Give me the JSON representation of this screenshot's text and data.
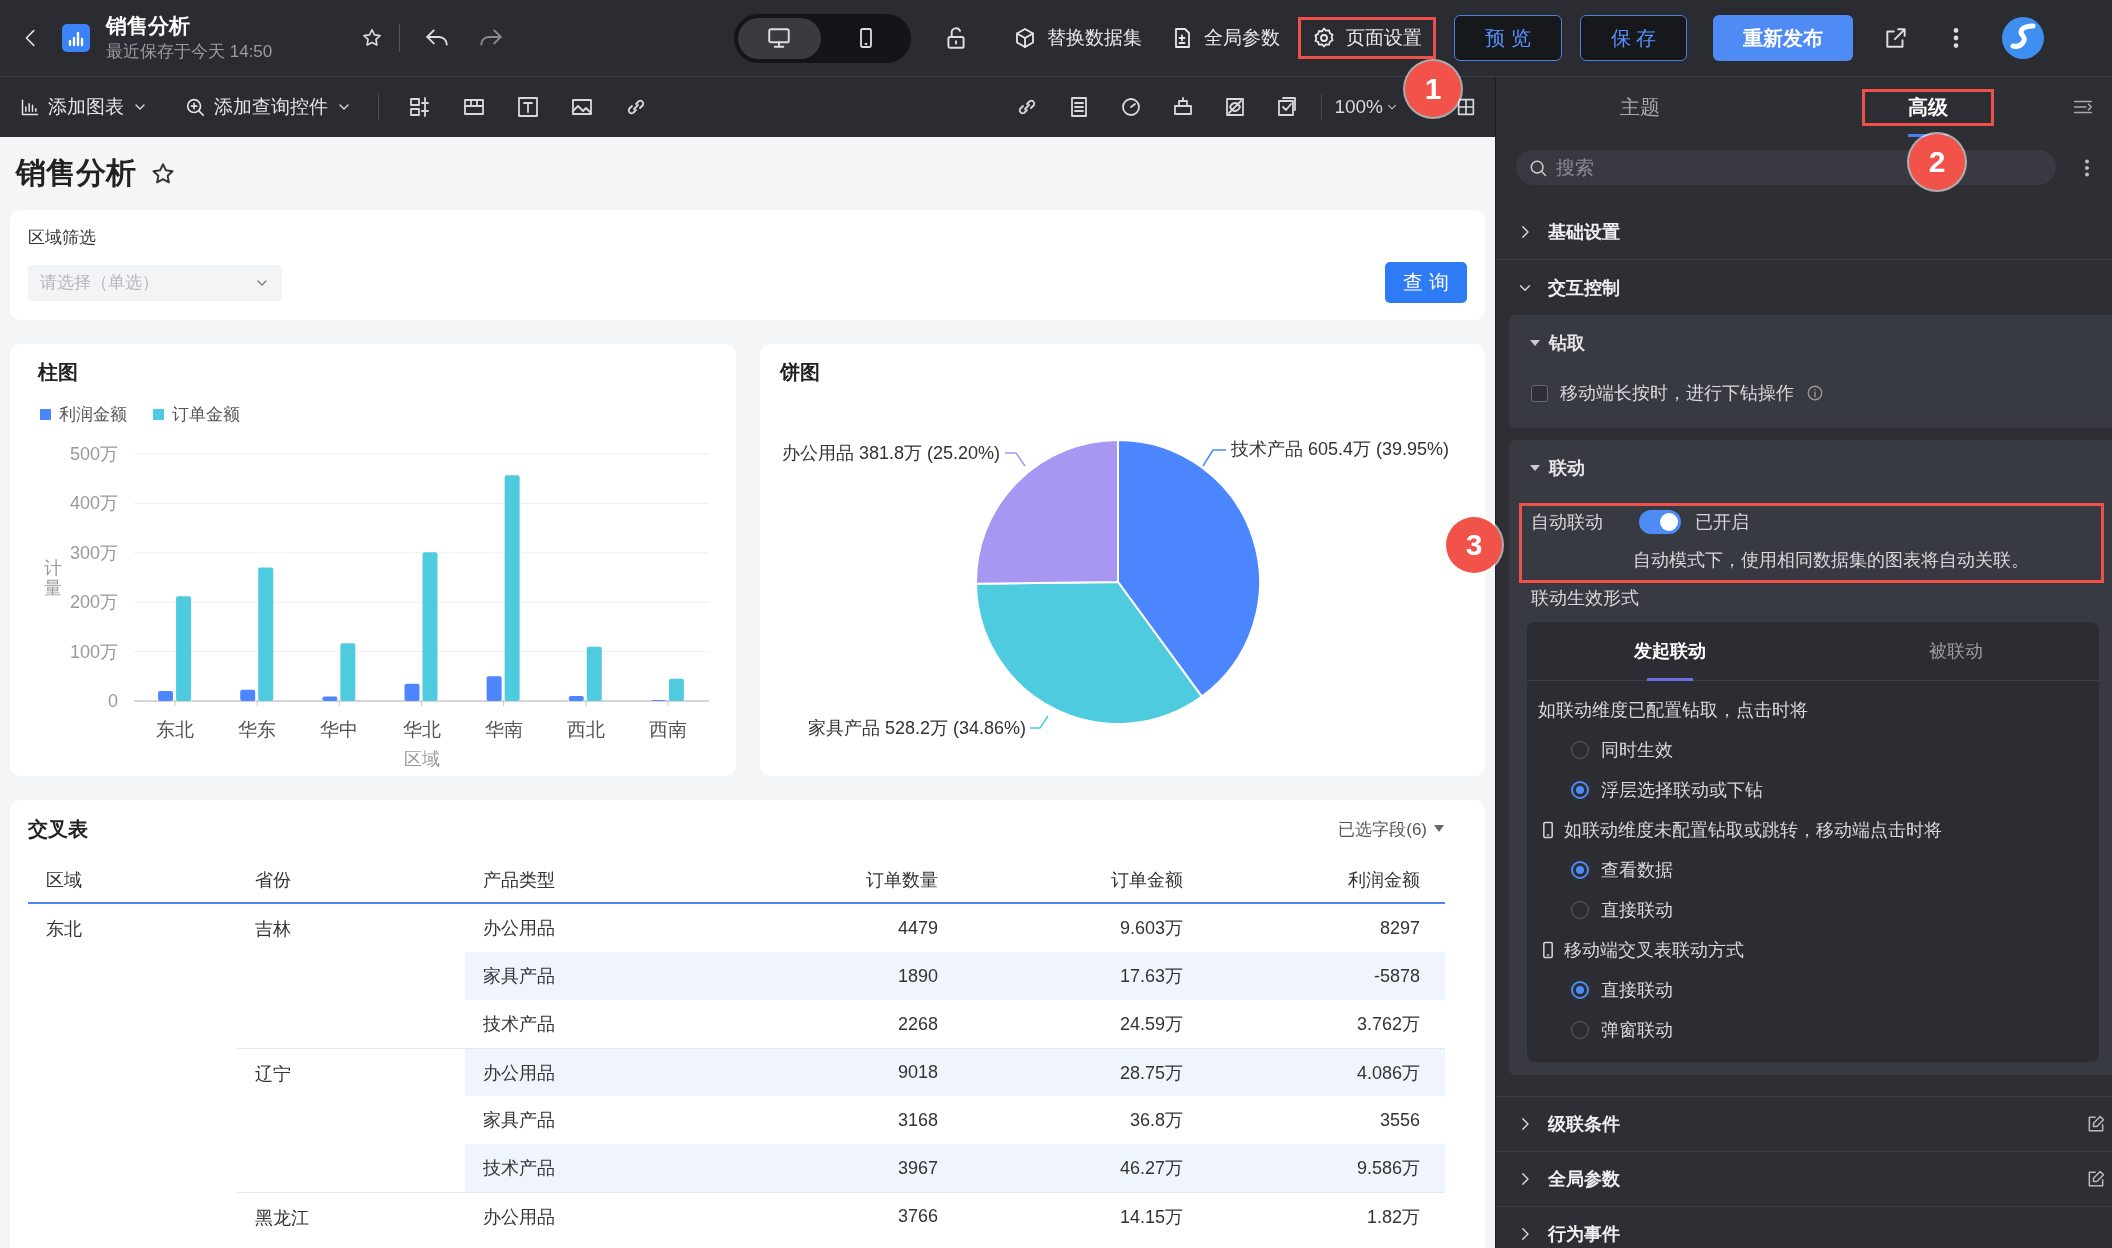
{
  "header": {
    "title": "销售分析",
    "subtitle": "最近保存于今天 14:50",
    "device_modes": [
      {
        "kind": "desktop",
        "selected": true
      },
      {
        "kind": "mobile",
        "selected": false
      }
    ],
    "actions": [
      {
        "label": "替换数据集",
        "highlighted": false
      },
      {
        "label": "全局参数",
        "highlighted": false
      },
      {
        "label": "页面设置",
        "highlighted": true
      }
    ],
    "buttons": [
      {
        "label": "预 览",
        "kind": "outline"
      },
      {
        "label": "保 存",
        "kind": "outline"
      },
      {
        "label": "重新发布",
        "kind": "primary"
      }
    ]
  },
  "toolbar": {
    "menus": [
      {
        "label": "添加图表"
      },
      {
        "label": "添加查询控件"
      }
    ],
    "zoom": "100%"
  },
  "page": {
    "title": "销售分析",
    "filter": {
      "label": "区域筛选",
      "placeholder": "请选择（单选）",
      "button": "查 询"
    },
    "bar_card": {
      "chart_data": {
        "type": "bar",
        "title": "柱图",
        "xlabel": "区域",
        "ylabel": "计量",
        "categories": [
          "东北",
          "华东",
          "华中",
          "华北",
          "华南",
          "西北",
          "西南"
        ],
        "series": [
          {
            "name": "利润金额",
            "color": "#4c86ff",
            "values": [
              20,
              23,
              9,
              35,
              50,
              10,
              2
            ]
          },
          {
            "name": "订单金额",
            "color": "#4ecbdf",
            "values": [
              212,
              270,
              117,
              301,
              457,
              110,
              45
            ]
          }
        ],
        "ylim": [
          0,
          500
        ],
        "grid": true,
        "yticks": [
          {
            "value": 0,
            "label": "0"
          },
          {
            "value": 100,
            "label": "100万"
          },
          {
            "value": 200,
            "label": "200万"
          },
          {
            "value": 300,
            "label": "300万"
          },
          {
            "value": 400,
            "label": "400万"
          },
          {
            "value": 500,
            "label": "500万"
          }
        ]
      }
    },
    "pie_card": {
      "chart_data": {
        "type": "pie",
        "title": "饼图",
        "categories": [
          "技术产品",
          "家具产品",
          "办公用品"
        ],
        "values": [
          605.4,
          528.2,
          381.8
        ],
        "colors": [
          "#4c86ff",
          "#4ecbdf",
          "#a797f3"
        ],
        "value_labels": [
          "605.4万 (39.95%)",
          "528.2万 (34.86%)",
          "381.8万 (25.20%)"
        ]
      }
    },
    "table_card": {
      "title": "交叉表",
      "fields_selector": "已选字段(6)",
      "columns": [
        "区域",
        "省份",
        "产品类型",
        "订单数量",
        "订单金额",
        "利润金额"
      ],
      "groups": [
        {
          "region": "东北",
          "provinces": [
            {
              "name": "吉林",
              "rows": [
                {
                  "product": "办公用品",
                  "cells": [
                    "4479",
                    "9.603万",
                    "8297"
                  ]
                },
                {
                  "product": "家具产品",
                  "cells": [
                    "1890",
                    "17.63万",
                    "-5878"
                  ]
                },
                {
                  "product": "技术产品",
                  "cells": [
                    "2268",
                    "24.59万",
                    "3.762万"
                  ]
                }
              ]
            },
            {
              "name": "辽宁",
              "rows": [
                {
                  "product": "办公用品",
                  "cells": [
                    "9018",
                    "28.75万",
                    "4.086万"
                  ]
                },
                {
                  "product": "家具产品",
                  "cells": [
                    "3168",
                    "36.8万",
                    "3556"
                  ]
                },
                {
                  "product": "技术产品",
                  "cells": [
                    "3967",
                    "46.27万",
                    "9.586万"
                  ]
                }
              ]
            },
            {
              "name": "黑龙江",
              "rows": [
                {
                  "product": "办公用品",
                  "cells": [
                    "3766",
                    "14.15万",
                    "1.82万"
                  ]
                }
              ]
            }
          ]
        }
      ]
    }
  },
  "settings_panel": {
    "tabs": [
      {
        "label": "主题",
        "selected": false,
        "highlighted": false
      },
      {
        "label": "高级",
        "selected": true,
        "highlighted": true
      }
    ],
    "search": {
      "placeholder": "搜索"
    },
    "sections": [
      {
        "title": "基础设置",
        "expanded": false,
        "editable": false
      },
      {
        "title": "交互控制",
        "expanded": true,
        "editable": false,
        "groups": [
          {
            "title": "钻取",
            "items": [
              {
                "kind": "checkbox",
                "label": "移动端长按时，进行下钻操作",
                "checked": false,
                "info": true
              }
            ]
          },
          {
            "title": "联动",
            "items": [
              {
                "kind": "toggle",
                "label": "自动联动",
                "on": true,
                "status": "已开启",
                "description": "自动模式下，使用相同数据集的图表将自动关联。",
                "highlighted": true
              },
              {
                "kind": "heading",
                "label": "联动生效形式"
              },
              {
                "kind": "tabbox",
                "tabs": [
                  {
                    "label": "发起联动",
                    "selected": true
                  },
                  {
                    "label": "被联动",
                    "selected": false
                  }
                ],
                "blocks": [
                  {
                    "label": "如联动维度已配置钻取，点击时将",
                    "mobile": false,
                    "options": [
                      {
                        "label": "同时生效",
                        "selected": false
                      },
                      {
                        "label": "浮层选择联动或下钻",
                        "selected": true
                      }
                    ]
                  },
                  {
                    "label": "如联动维度未配置钻取或跳转，移动端点击时将",
                    "mobile": true,
                    "options": [
                      {
                        "label": "查看数据",
                        "selected": true
                      },
                      {
                        "label": "直接联动",
                        "selected": false
                      }
                    ]
                  },
                  {
                    "label": "移动端交叉表联动方式",
                    "mobile": true,
                    "options": [
                      {
                        "label": "直接联动",
                        "selected": true
                      },
                      {
                        "label": "弹窗联动",
                        "selected": false
                      }
                    ]
                  }
                ]
              }
            ]
          }
        ]
      },
      {
        "title": "级联条件",
        "expanded": false,
        "editable": true
      },
      {
        "title": "全局参数",
        "expanded": false,
        "editable": true
      },
      {
        "title": "行为事件",
        "expanded": false,
        "editable": false
      }
    ]
  },
  "callouts": [
    {
      "number": "1"
    },
    {
      "number": "2"
    },
    {
      "number": "3"
    }
  ]
}
